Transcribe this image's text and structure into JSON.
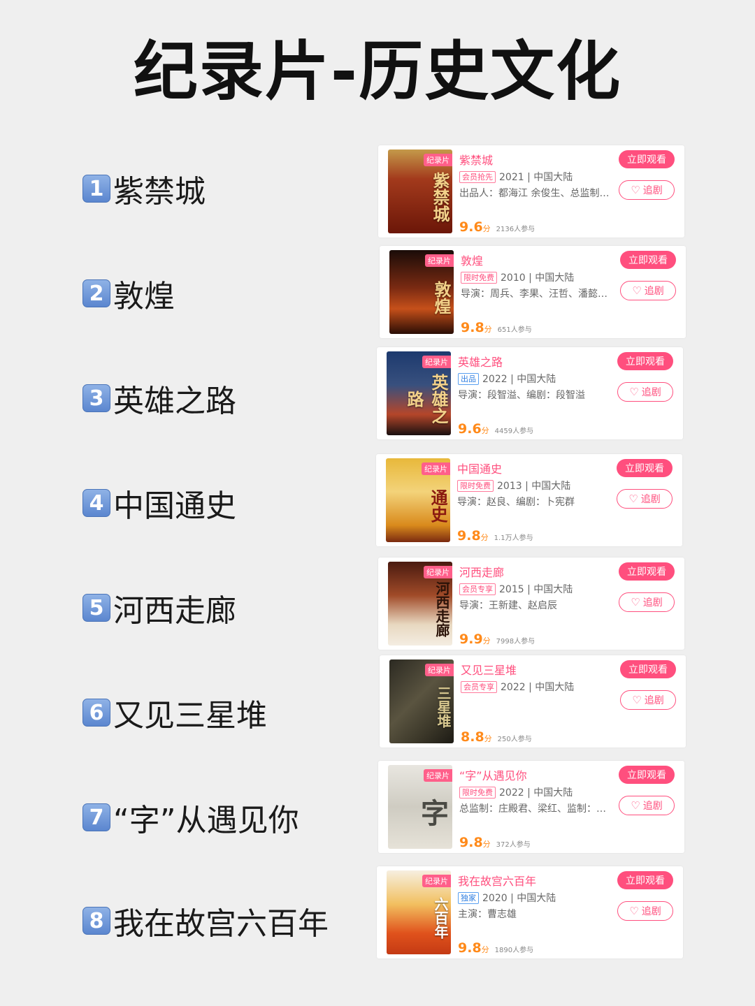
{
  "page_title": "纪录片-历史文化",
  "colors": {
    "accent": "#ff4f7e",
    "score": "#ff8a1a",
    "badge": "#6b93d6"
  },
  "icons": {
    "follow": "heart-icon"
  },
  "items": [
    {
      "num": "1",
      "label": "紫禁城",
      "tag": "纪录片",
      "name": "紫禁城",
      "badge": "会员抢先",
      "year_region": "2021 | 中国大陆",
      "credits": "出品人：都海江 余俊生、总监制：...",
      "score": "9.6",
      "score_unit": "分",
      "count": "2136人参与",
      "watch": "立即观看",
      "follow": "追剧",
      "poster_text": "紫禁城"
    },
    {
      "num": "2",
      "label": "敦煌",
      "tag": "纪录片",
      "name": "敦煌",
      "badge": "限时免费",
      "year_region": "2010 | 中国大陆",
      "credits": "导演：周兵、李果、汪哲、潘懿、...",
      "score": "9.8",
      "score_unit": "分",
      "count": "651人参与",
      "watch": "立即观看",
      "follow": "追剧",
      "poster_text": "敦煌"
    },
    {
      "num": "3",
      "label": "英雄之路",
      "tag": "纪录片",
      "name": "英雄之路",
      "badge": "出品",
      "year_region": "2022 | 中国大陆",
      "credits": "导演：段智溢、编剧：段智溢",
      "score": "9.6",
      "score_unit": "分",
      "count": "4459人参与",
      "watch": "立即观看",
      "follow": "追剧",
      "poster_text": "英雄之路"
    },
    {
      "num": "4",
      "label": "中国通史",
      "tag": "纪录片",
      "name": "中国通史",
      "badge": "限时免费",
      "year_region": "2013 | 中国大陆",
      "credits": "导演：赵良、编剧：卜宪群",
      "score": "9.8",
      "score_unit": "分",
      "count": "1.1万人参与",
      "watch": "立即观看",
      "follow": "追剧",
      "poster_text": "通史"
    },
    {
      "num": "5",
      "label": "河西走廊",
      "tag": "纪录片",
      "name": "河西走廊",
      "badge": "会员专享",
      "year_region": "2015 | 中国大陆",
      "credits": "导演：王新建、赵启辰",
      "score": "9.9",
      "score_unit": "分",
      "count": "7998人参与",
      "watch": "立即观看",
      "follow": "追剧",
      "poster_text": "河西走廊"
    },
    {
      "num": "6",
      "label": "又见三星堆",
      "tag": "纪录片",
      "name": "又见三星堆",
      "badge": "会员专享",
      "year_region": "2022 | 中国大陆",
      "credits": "",
      "score": "8.8",
      "score_unit": "分",
      "count": "250人参与",
      "watch": "立即观看",
      "follow": "追剧",
      "poster_text": "三星堆"
    },
    {
      "num": "7",
      "label": "“字”从遇见你",
      "tag": "纪录片",
      "name": "“字”从遇见你",
      "badge": "限时免费",
      "year_region": "2022 | 中国大陆",
      "credits": "总监制：庄殿君、梁红、监制：王...",
      "score": "9.8",
      "score_unit": "分",
      "count": "372人参与",
      "watch": "立即观看",
      "follow": "追剧",
      "poster_text": "字"
    },
    {
      "num": "8",
      "label": "我在故宫六百年",
      "tag": "纪录片",
      "name": "我在故宫六百年",
      "badge": "独家",
      "year_region": "2020 | 中国大陆",
      "credits": "主演：曹志雄",
      "score": "9.8",
      "score_unit": "分",
      "count": "1890人参与",
      "watch": "立即观看",
      "follow": "追剧",
      "poster_text": "六百年"
    }
  ]
}
